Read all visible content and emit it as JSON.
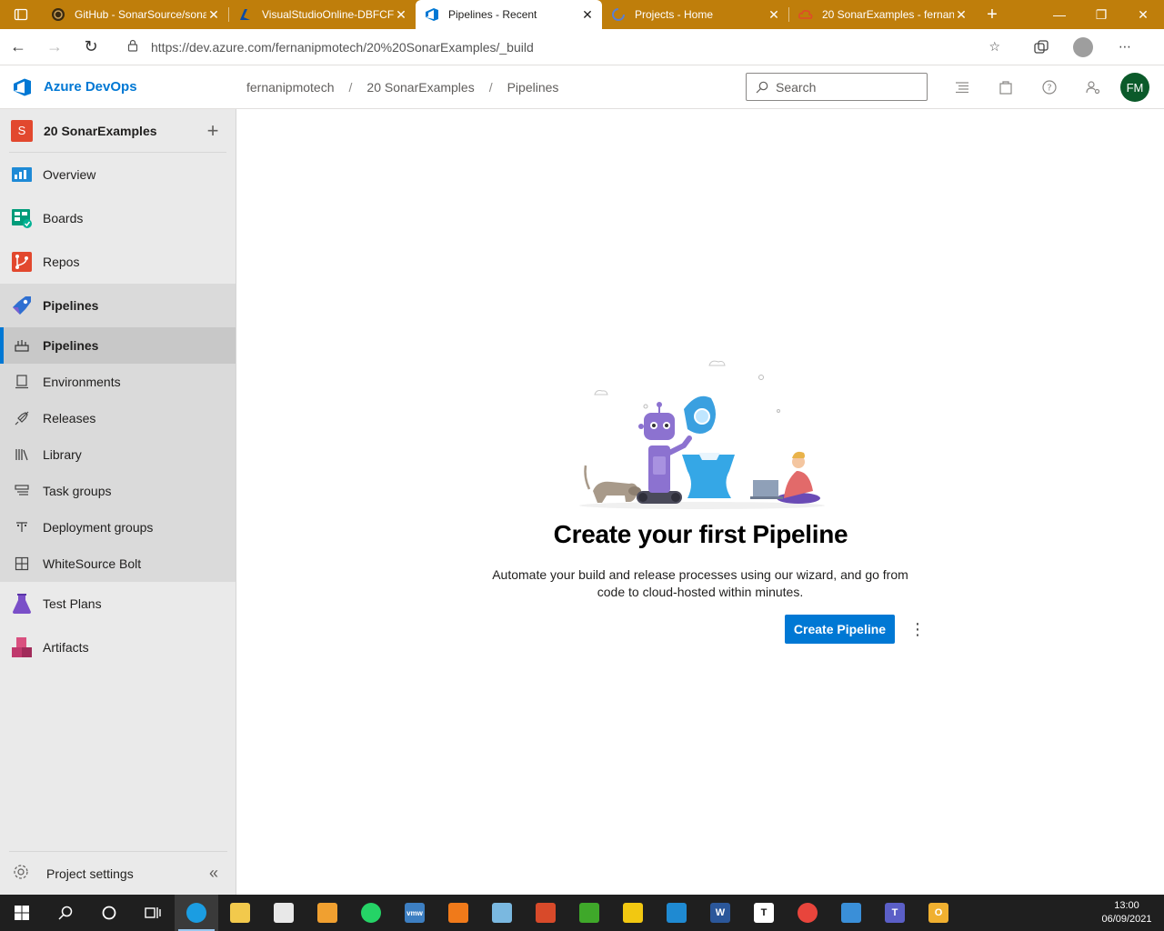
{
  "browser": {
    "tabs": [
      {
        "title": "GitHub - SonarSource/sonar",
        "icon": "github-icon",
        "active": false
      },
      {
        "title": "VisualStudioOnline-DBFCF",
        "icon": "azure-icon",
        "active": false
      },
      {
        "title": "Pipelines - Recent",
        "icon": "devops-icon",
        "active": true
      },
      {
        "title": "Projects - Home",
        "icon": "loading-icon",
        "active": false
      },
      {
        "title": "20 SonarExamples - fernan",
        "icon": "cloud-icon",
        "active": false
      }
    ],
    "address": "https://dev.azure.com/fernanipmotech/20%20SonarExamples/_build"
  },
  "header": {
    "product": "Azure DevOps",
    "breadcrumb": [
      "fernanipmotech",
      "20 SonarExamples",
      "Pipelines"
    ],
    "search_placeholder": "Search",
    "avatar_initials": "FM"
  },
  "sidebar": {
    "project_initial": "S",
    "project_name": "20 SonarExamples",
    "items": [
      {
        "label": "Overview"
      },
      {
        "label": "Boards"
      },
      {
        "label": "Repos"
      },
      {
        "label": "Pipelines"
      }
    ],
    "sub_items": [
      {
        "label": "Pipelines"
      },
      {
        "label": "Environments"
      },
      {
        "label": "Releases"
      },
      {
        "label": "Library"
      },
      {
        "label": "Task groups"
      },
      {
        "label": "Deployment groups"
      },
      {
        "label": "WhiteSource Bolt"
      }
    ],
    "bottom_items": [
      {
        "label": "Test Plans"
      },
      {
        "label": "Artifacts"
      }
    ],
    "settings_label": "Project settings"
  },
  "main": {
    "title": "Create your first Pipeline",
    "description": "Automate your build and release processes using our wizard, and go from code to cloud-hosted within minutes.",
    "create_button": "Create Pipeline"
  },
  "taskbar": {
    "time": "13:00",
    "date": "06/09/2021"
  },
  "colors": {
    "accent": "#0078d4",
    "tabstrip": "#bf7e0b",
    "avatar": "#0b5a2a",
    "project_badge": "#e2482e"
  }
}
